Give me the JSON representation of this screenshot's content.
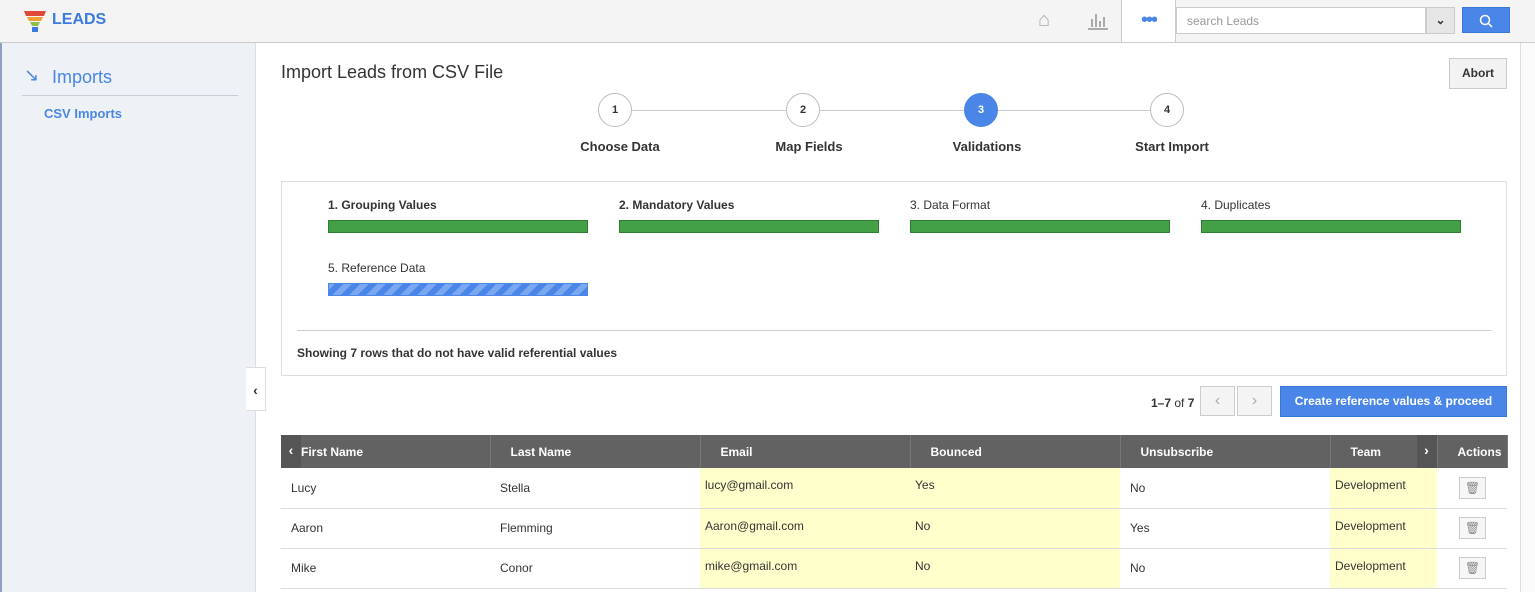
{
  "app": {
    "name": "LEADS",
    "search_placeholder": "search Leads",
    "more_label": "•••"
  },
  "sidebar": {
    "section": "Imports",
    "items": [
      {
        "label": "CSV Imports"
      }
    ]
  },
  "page": {
    "title": "Import Leads from CSV File",
    "abort_label": "Abort"
  },
  "steps": [
    {
      "num": "1",
      "label": "Choose Data"
    },
    {
      "num": "2",
      "label": "Map Fields"
    },
    {
      "num": "3",
      "label": "Validations",
      "active": true
    },
    {
      "num": "4",
      "label": "Start Import"
    }
  ],
  "validations": [
    {
      "label": "1. Grouping Values",
      "progress": 100,
      "bold": true
    },
    {
      "label": "2. Mandatory Values",
      "progress": 100,
      "bold": true
    },
    {
      "label": "3. Data Format",
      "progress": 100
    },
    {
      "label": "4. Duplicates",
      "progress": 100
    },
    {
      "label": "5. Reference Data",
      "progress": 100,
      "in_progress": true
    }
  ],
  "note": "Showing 7 rows that do not have valid referential values",
  "pager": {
    "range": "1–7",
    "of": "of",
    "total": "7"
  },
  "proceed_label": "Create reference values & proceed",
  "table": {
    "columns": [
      "First Name",
      "Last Name",
      "Email",
      "Bounced",
      "Unsubscribe",
      "Team",
      "Actions"
    ],
    "rows": [
      [
        "Lucy",
        "Stella",
        "lucy@gmail.com",
        "Yes",
        "No",
        "Development"
      ],
      [
        "Aaron",
        "Flemming",
        "Aaron@gmail.com",
        "No",
        "Yes",
        "Development"
      ],
      [
        "Mike",
        "Conor",
        "mike@gmail.com",
        "No",
        "No",
        "Development"
      ]
    ]
  },
  "colors": {
    "accent": "#4a86e8",
    "success": "#43a047",
    "highlight": "#ffffcc",
    "header": "#626262"
  }
}
